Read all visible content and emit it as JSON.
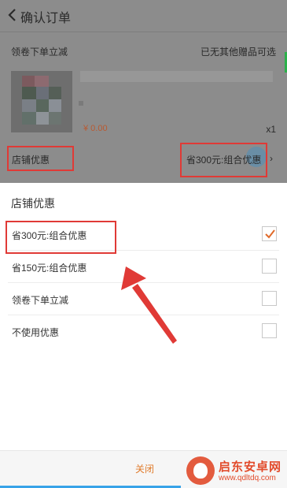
{
  "header": {
    "title": "确认订单"
  },
  "order": {
    "coupon_row_left": "领卷下单立减",
    "coupon_row_right": "已无其他赠品可选",
    "price": "¥ 0.00",
    "quantity": "x1",
    "shop_discount_label": "店铺优惠",
    "shop_discount_value": "省300元:组合优惠",
    "chevron": "›"
  },
  "sheet": {
    "title": "店铺优惠",
    "options": [
      {
        "label": "省300元:组合优惠",
        "checked": true
      },
      {
        "label": "省150元:组合优惠",
        "checked": false
      },
      {
        "label": "领卷下单立减",
        "checked": false
      },
      {
        "label": "不使用优惠",
        "checked": false
      }
    ],
    "close_label": "关闭"
  },
  "watermark": {
    "title": "启东安卓网",
    "url": "www.qdltdq.com"
  },
  "colors": {
    "annotation_red": "#e03a36",
    "check_orange": "#e06a2a",
    "close_orange": "#e07a2a",
    "accent_blue": "#38a3e8"
  },
  "icons": {
    "back": "back-arrow-icon",
    "check": "checkmark-icon",
    "chevron": "chevron-right-icon"
  }
}
